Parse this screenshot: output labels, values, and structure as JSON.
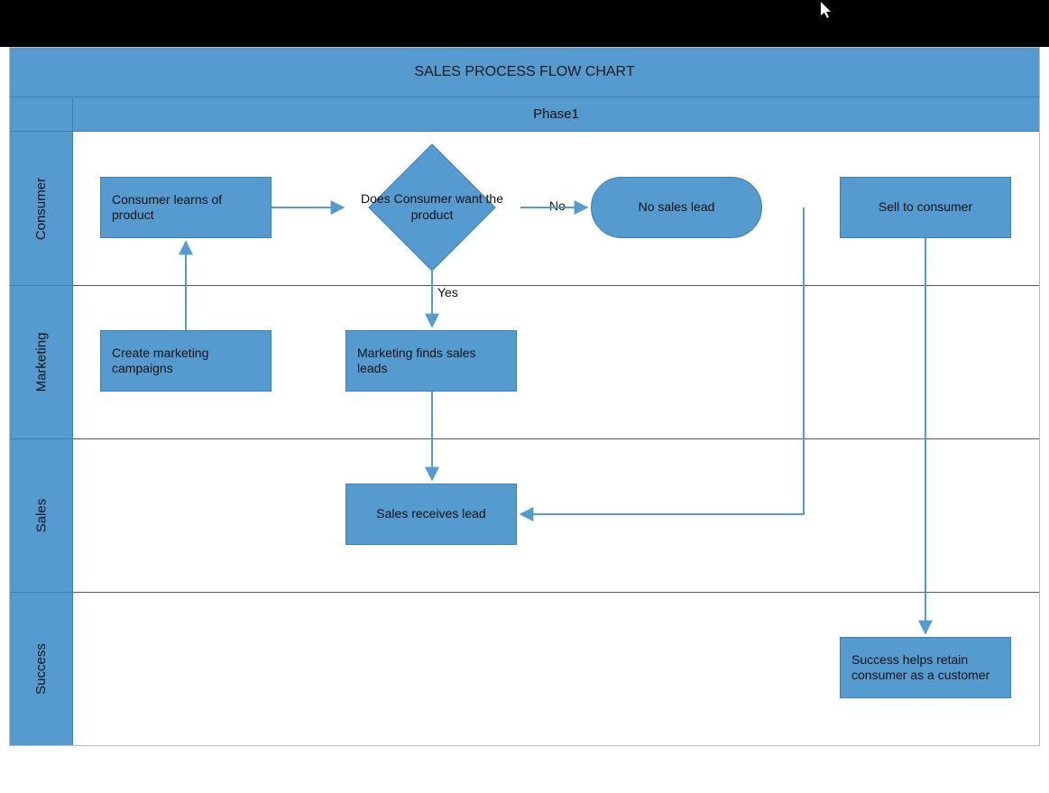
{
  "title": "SALES PROCESS FLOW CHART",
  "phase": "Phase1",
  "lanes": {
    "consumer": "Consumer",
    "marketing": "Marketing",
    "sales": "Sales",
    "success": "Success"
  },
  "nodes": {
    "consumer_learns": "Consumer learns of product",
    "decision": "Does Consumer want the product",
    "no_lead": "No sales lead",
    "sell": "Sell to consumer",
    "create_campaign": "Create marketing campaigns",
    "marketing_finds": "Marketing finds sales leads",
    "sales_receives": "Sales receives lead",
    "success_retain": "Success helps retain consumer as a customer"
  },
  "labels": {
    "no": "No",
    "yes": "Yes"
  },
  "colors": {
    "accent": "#569bcf",
    "accentBorder": "#3b7fb3"
  },
  "chart_data": {
    "type": "swimlane-flowchart",
    "title": "SALES PROCESS FLOW CHART",
    "phases": [
      "Phase1"
    ],
    "lanes": [
      "Consumer",
      "Marketing",
      "Sales",
      "Success"
    ],
    "nodes": [
      {
        "id": "consumer_learns",
        "lane": "Consumer",
        "shape": "process",
        "label": "Consumer learns of product"
      },
      {
        "id": "decision",
        "lane": "Consumer",
        "shape": "decision",
        "label": "Does Consumer want the product"
      },
      {
        "id": "no_lead",
        "lane": "Consumer",
        "shape": "terminator",
        "label": "No sales lead"
      },
      {
        "id": "sell",
        "lane": "Consumer",
        "shape": "process",
        "label": "Sell to consumer"
      },
      {
        "id": "create_campaign",
        "lane": "Marketing",
        "shape": "process",
        "label": "Create marketing campaigns"
      },
      {
        "id": "marketing_finds",
        "lane": "Marketing",
        "shape": "process",
        "label": "Marketing finds sales leads"
      },
      {
        "id": "sales_receives",
        "lane": "Sales",
        "shape": "process",
        "label": "Sales receives lead"
      },
      {
        "id": "success_retain",
        "lane": "Success",
        "shape": "process",
        "label": "Success helps retain consumer as a customer"
      }
    ],
    "edges": [
      {
        "from": "consumer_learns",
        "to": "decision"
      },
      {
        "from": "decision",
        "to": "no_lead",
        "label": "No"
      },
      {
        "from": "decision",
        "to": "marketing_finds",
        "label": "Yes"
      },
      {
        "from": "create_campaign",
        "to": "consumer_learns"
      },
      {
        "from": "marketing_finds",
        "to": "sales_receives"
      },
      {
        "from": "no_lead",
        "to": "sales_receives"
      },
      {
        "from": "sell",
        "to": "success_retain"
      }
    ]
  }
}
